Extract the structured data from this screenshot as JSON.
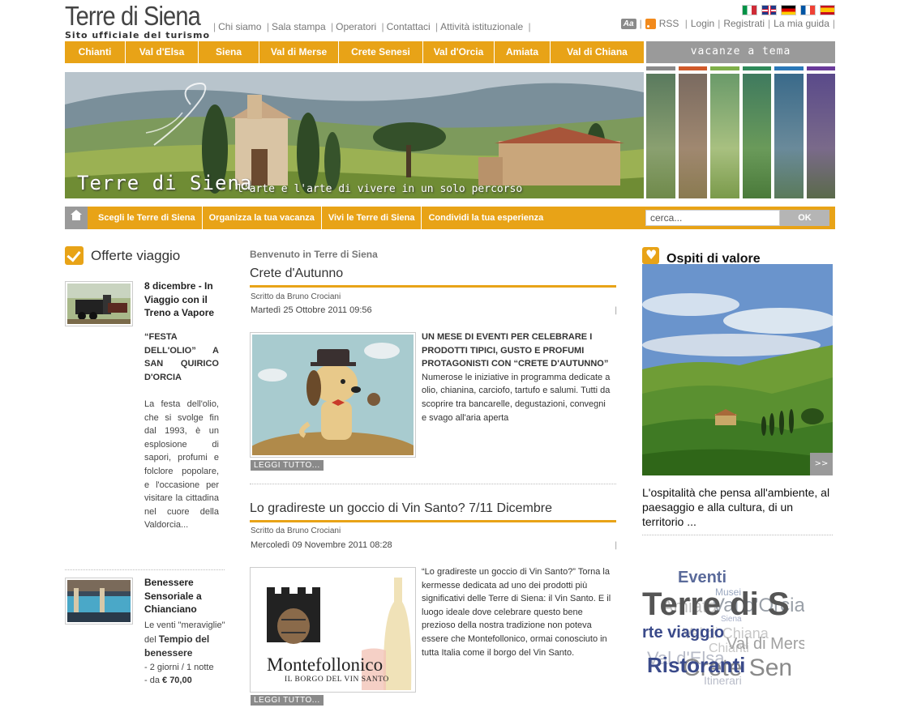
{
  "header": {
    "logo_title": "Terre di Siena",
    "logo_subtitle": "Sito ufficiale del turismo",
    "top_links": [
      "Chi siamo",
      "Sala stampa",
      "Operatori",
      "Contattaci",
      "Attività istituzionale"
    ],
    "aa_label": "Aa",
    "rss_label": "RSS",
    "user_links": [
      "Login",
      "Registrati",
      "La mia guida"
    ],
    "flags": [
      "it",
      "uk",
      "de",
      "fr",
      "es"
    ]
  },
  "main_nav": [
    "Chianti",
    "Val d'Elsa",
    "Siena",
    "Val di Merse",
    "Crete Senesi",
    "Val d'Orcia",
    "Amiata",
    "Val di Chiana"
  ],
  "vacanze_label": "vacanze a tema",
  "banner": {
    "title": "Terre di Siena",
    "tagline": "l'arte e l'arte di vivere in un solo percorso"
  },
  "theme_strip_colors": [
    "#8a8a8a",
    "#d05a2a",
    "#7fb04a",
    "#2f8a5a",
    "#2a78b8",
    "#6a3a9a"
  ],
  "secondary_nav": [
    "Scegli le Terre di Siena",
    "Organizza la tua vacanza",
    "Vivi le Terre di Siena",
    "Condividi la tua esperienza"
  ],
  "search": {
    "placeholder": "cerca...",
    "button": "OK"
  },
  "offerte": {
    "title": "Offerte viaggio",
    "items": [
      {
        "title": "8 dicembre - In Viaggio con il Treno a Vapore",
        "subtitle": "“FESTA DELL'OLIO” A SAN QUIRICO D'ORCIA",
        "text": "La festa dell'olio, che si svolge fin dal 1993, è un esplosione di sapori, profumi e folclore popolare, e l'occasione per visitare la cittadina nel cuore della Valdorcia..."
      },
      {
        "title": "Benessere Sensoriale a Chianciano",
        "text_intro": "Le venti \"meraviglie\" del",
        "text_bold": "Tempio del benessere",
        "text_line1": "- 2 giorni / 1 notte",
        "text_line2_prefix": "- da ",
        "price": "€ 70,00"
      }
    ]
  },
  "center": {
    "welcome": "Benvenuto in Terre di Siena",
    "articles": [
      {
        "title": "Crete d'Autunno",
        "author": "Scritto da Bruno Crociani",
        "date": "Martedì 25 Ottobre 2011 09:56",
        "bold_text": "UN MESE DI EVENTI PER CELEBRARE I PRODOTTI TIPICI, GUSTO E PROFUMI PROTAGONISTI CON “CRETE D'AUTUNNO”",
        "text": "Numerose le iniziative in programma dedicate a olio, chianina, carciofo, tartufo e salumi. Tutti da scoprire tra bancarelle, degustazioni, convegni  e svago all'aria aperta",
        "read_more": "LEGGI TUTTO..."
      },
      {
        "title": "Lo gradireste un goccio di Vin Santo? 7/11 Dicembre",
        "author": "Scritto da Bruno Crociani",
        "date": "Mercoledì 09 Novembre 2011 08:28",
        "text": "“Lo gradireste un goccio di Vin Santo?” Torna la kermesse dedicata ad uno dei prodotti più significativi delle Terre di Siena: il Vin Santo. E il luogo ideale dove celebrare questo bene prezioso della nostra tradizione non poteva essere che Montefollonico, ormai conosciuto in tutta Italia come il borgo del Vin Santo.",
        "image_title": "Montefollonico",
        "image_subtitle": "IL BORGO DEL VIN SANTO",
        "read_more": "LEGGI TUTTO..."
      }
    ]
  },
  "ospiti": {
    "title": "Ospiti di valore",
    "arrow": ">>",
    "text": "L'ospitalità che pensa all'ambiente, al paesaggio e alla cultura, di un territorio ..."
  },
  "tag_cloud": [
    "Eventi",
    "Musei",
    "Terre di S",
    "Amiata",
    "Val d'Orcia",
    "Siena",
    "rte viaggio",
    "Val di Chiana",
    "Chianti",
    "Val di Mers",
    "Val d'Elsa",
    "Ristoranti",
    "Crete Sen",
    "Itinerari"
  ]
}
